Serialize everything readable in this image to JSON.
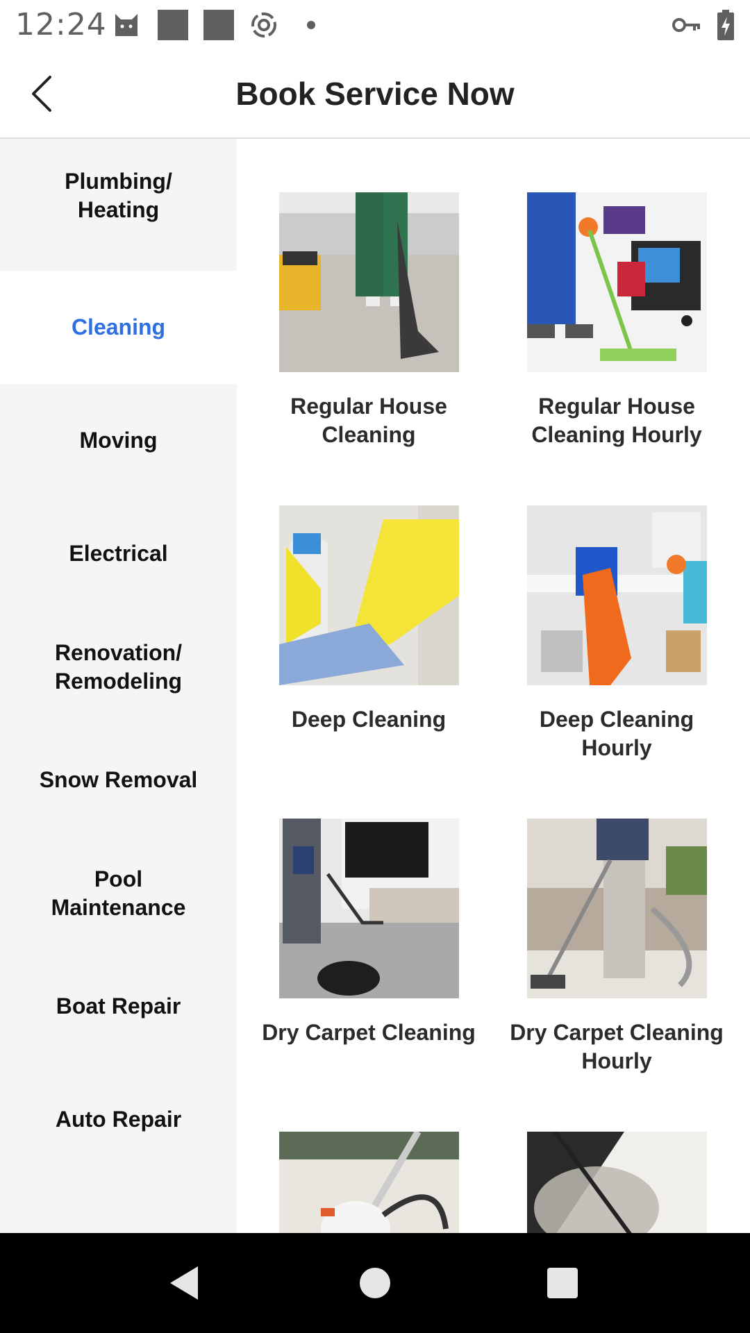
{
  "status_bar": {
    "time": "12:24",
    "icons": [
      "cat-icon",
      "square-icon",
      "square-icon",
      "spiral-icon",
      "dot-icon",
      "key-icon",
      "battery-charging-icon"
    ]
  },
  "app_bar": {
    "title": "Book Service Now",
    "back_icon": "chevron-left-icon"
  },
  "sidebar": {
    "items": [
      {
        "label": "Plumbing/\nHeating",
        "active": false
      },
      {
        "label": "Cleaning",
        "active": true
      },
      {
        "label": "Moving",
        "active": false
      },
      {
        "label": "Electrical",
        "active": false
      },
      {
        "label": "Renovation/\nRemodeling",
        "active": false
      },
      {
        "label": "Snow Removal",
        "active": false
      },
      {
        "label": "Pool\nMaintenance",
        "active": false
      },
      {
        "label": "Boat Repair",
        "active": false
      },
      {
        "label": "Auto Repair",
        "active": false
      }
    ]
  },
  "services": [
    {
      "label": "Regular House\nCleaning",
      "image": "vacuum-carpet-photo"
    },
    {
      "label": "Regular House\nCleaning Hourly",
      "image": "mop-cart-photo"
    },
    {
      "label": "Deep Cleaning",
      "image": "yellow-glove-spray-photo"
    },
    {
      "label": "Deep Cleaning\nHourly",
      "image": "orange-glove-cloth-photo"
    },
    {
      "label": "Dry Carpet Cleaning",
      "image": "canister-vacuum-photo"
    },
    {
      "label": "Dry Carpet Cleaning\nHourly",
      "image": "upright-vacuum-photo"
    },
    {
      "label": "",
      "image": "steam-vacuum-photo"
    },
    {
      "label": "",
      "image": "steam-cleaner-photo"
    }
  ],
  "colors": {
    "accent": "#2f6fe0",
    "sidebar_bg": "#f4f5f7",
    "navbar_bg": "#000000"
  },
  "nav_bar": {
    "icons": [
      "back-triangle-icon",
      "home-circle-icon",
      "recents-square-icon"
    ]
  }
}
